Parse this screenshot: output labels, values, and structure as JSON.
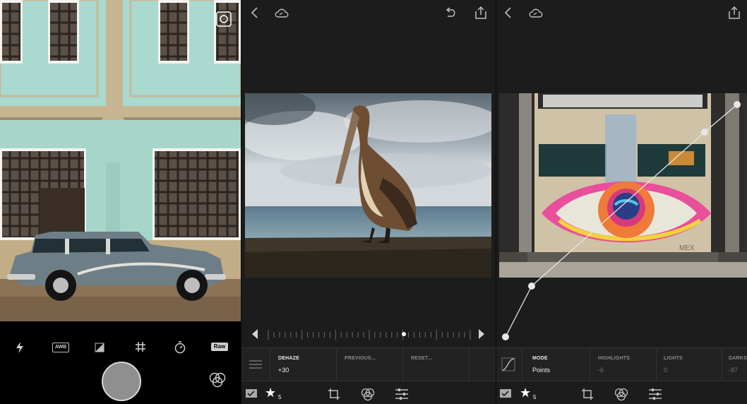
{
  "camera": {
    "modes": [
      {
        "id": "flash",
        "label": ""
      },
      {
        "id": "awb",
        "label": "AWB"
      },
      {
        "id": "exposure",
        "label": ""
      },
      {
        "id": "grid",
        "label": ""
      },
      {
        "id": "timer",
        "label": ""
      },
      {
        "id": "raw",
        "label": "Raw"
      }
    ]
  },
  "editor": {
    "slider": {
      "value_fraction": 0.67
    },
    "adjust_bar": {
      "dehaze_label": "DEHAZE",
      "dehaze_value": "+30",
      "previous_label": "PREVIOUS...",
      "reset_label": "RESET..."
    },
    "rating": {
      "count": "5"
    }
  },
  "curve": {
    "bar": {
      "mode_label": "MODE",
      "mode_value": "Points",
      "highlights_label": "HIGHLIGHTS",
      "highlights_value": "-6",
      "lights_label": "LIGHTS",
      "lights_value": "0",
      "darks_label": "DARKS",
      "darks_value": "-87"
    },
    "rating": {
      "count": "5"
    }
  },
  "colors": {
    "panel_bg": "#1c1c1c",
    "bar_bg": "#222222",
    "shutter": "#8f8f8f"
  }
}
